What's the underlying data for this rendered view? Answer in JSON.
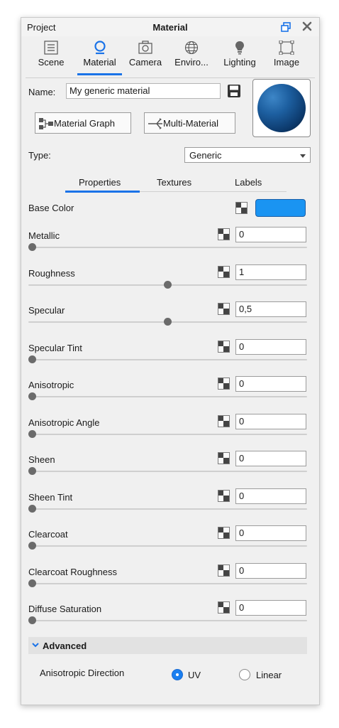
{
  "titlebar": {
    "left_tab": "Project",
    "title": "Material"
  },
  "tabs": [
    {
      "label": "Scene",
      "icon": "list-icon"
    },
    {
      "label": "Material",
      "icon": "material-icon",
      "active": true
    },
    {
      "label": "Camera",
      "icon": "camera-icon"
    },
    {
      "label": "Enviro...",
      "icon": "globe-icon"
    },
    {
      "label": "Lighting",
      "icon": "bulb-icon"
    },
    {
      "label": "Image",
      "icon": "image-frame-icon"
    }
  ],
  "name": {
    "label": "Name:",
    "value": "My generic material"
  },
  "buttons": {
    "graph": "Material Graph",
    "multi": "Multi-Material"
  },
  "type": {
    "label": "Type:",
    "value": "Generic"
  },
  "subtabs": {
    "properties": "Properties",
    "textures": "Textures",
    "labels": "Labels",
    "active": "Properties"
  },
  "base_color": {
    "label": "Base Color",
    "color": "#1a94f2"
  },
  "properties": [
    {
      "label": "Metallic",
      "value": "0",
      "slider": 0.0
    },
    {
      "label": "Roughness",
      "value": "1",
      "slider": 0.5
    },
    {
      "label": "Specular",
      "value": "0,5",
      "slider": 0.5
    },
    {
      "label": "Specular Tint",
      "value": "0",
      "slider": 0.0
    },
    {
      "label": "Anisotropic",
      "value": "0",
      "slider": 0.0
    },
    {
      "label": "Anisotropic Angle",
      "value": "0",
      "slider": 0.0
    },
    {
      "label": "Sheen",
      "value": "0",
      "slider": 0.0
    },
    {
      "label": "Sheen Tint",
      "value": "0",
      "slider": 0.0
    },
    {
      "label": "Clearcoat",
      "value": "0",
      "slider": 0.0
    },
    {
      "label": "Clearcoat Roughness",
      "value": "0",
      "slider": 0.0
    },
    {
      "label": "Diffuse Saturation",
      "value": "0",
      "slider": 0.0
    }
  ],
  "advanced": {
    "label": "Advanced",
    "direction_label": "Anisotropic Direction",
    "options": [
      "UV",
      "Linear"
    ],
    "selected": "UV"
  },
  "colors": {
    "accent": "#1a73e8",
    "radio_selected": "#1a7ff0"
  }
}
